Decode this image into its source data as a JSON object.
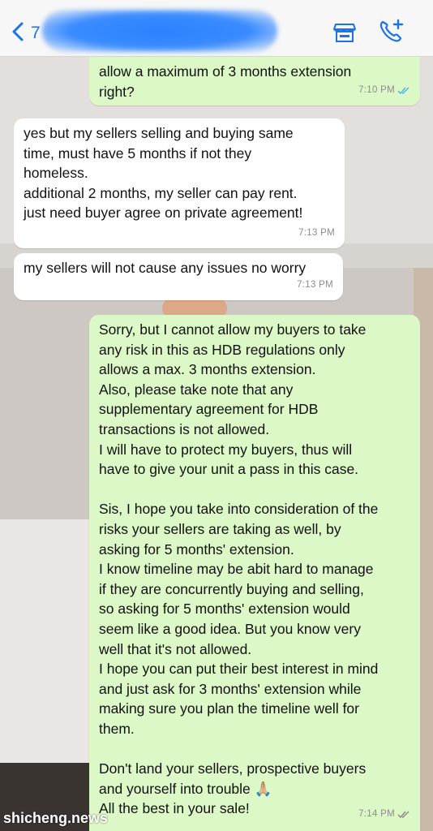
{
  "header": {
    "back_count": "7",
    "icons": {
      "back": "chevron-left-icon",
      "store": "store-icon",
      "call": "add-call-icon"
    },
    "accent": "#1a73e8"
  },
  "messages": [
    {
      "direction": "outgoing",
      "text": "allow a maximum of 3 months extension\nright?",
      "time": "7:10 PM"
    },
    {
      "direction": "incoming",
      "text": "yes but my sellers selling and buying same\ntime, must have 5 months if not they\nhomeless.\nadditional 2 months, my seller can pay rent.\njust need buyer agree on private agreement!",
      "time": "7:13 PM"
    },
    {
      "direction": "incoming",
      "text": "my sellers will not cause any issues no worry",
      "time": "7:13 PM"
    },
    {
      "direction": "outgoing",
      "text": "Sorry, but I cannot allow my buyers to take\nany risk in this as HDB regulations only\nallows a max. 3 months extension.\nAlso, please take note that any\nsupplementary agreement for HDB\ntransactions is not allowed.\nI will have to protect my buyers, thus will\nhave to give your unit a pass in this case.\n\nSis, I hope you take into consideration of the\nrisks your sellers are taking as well, by\nasking for 5 months' extension.\nI know timeline may be abit hard to manage\nif they are concurrently buying and selling,\nso asking for 5 months' extension would\nseem like a good idea. But you know very\nwell that it's not allowed.\nI hope you can put their best interest in mind\nand just ask for 3 months' extension while\nmaking sure you plan the timeline well for\nthem.\n\nDon't land your sellers, prospective buyers\nand yourself into trouble 🙏🏼\nAll the best in your sale!",
      "time": "7:14 PM"
    }
  ],
  "colors": {
    "outgoing": "#dcf8c6",
    "incoming": "#ffffff",
    "ticks": "#4fb6ec"
  },
  "watermark": "shicheng.news"
}
